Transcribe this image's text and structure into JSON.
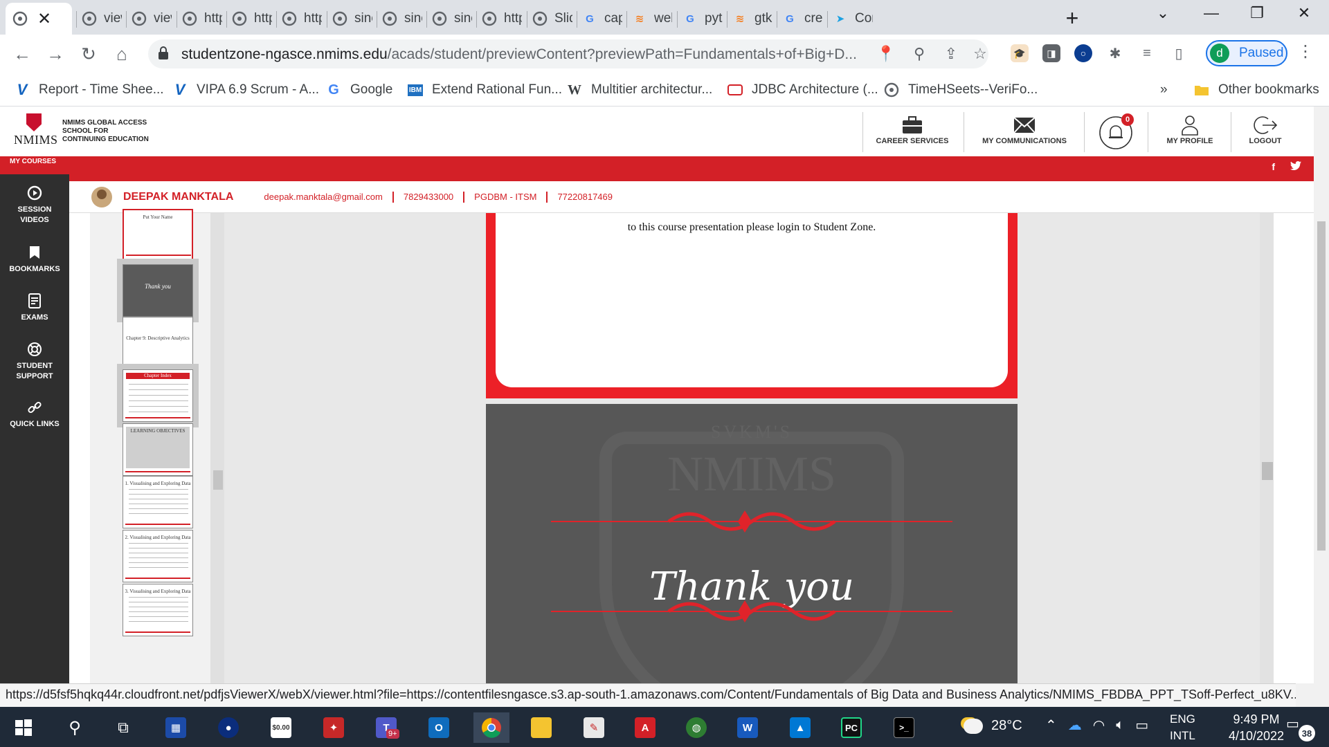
{
  "browser": {
    "tabs": [
      {
        "title": "view",
        "icon": "globe-icon"
      },
      {
        "title": "view",
        "icon": "globe-icon"
      },
      {
        "title": "http",
        "icon": "globe-icon"
      },
      {
        "title": "http",
        "icon": "globe-icon"
      },
      {
        "title": "http",
        "icon": "globe-icon"
      },
      {
        "title": "sinc",
        "icon": "globe-icon"
      },
      {
        "title": "sinc",
        "icon": "globe-icon"
      },
      {
        "title": "sinc",
        "icon": "globe-icon"
      },
      {
        "title": "http",
        "icon": "globe-icon"
      },
      {
        "title": "Slid",
        "icon": "globe-icon"
      },
      {
        "title": "cap",
        "icon": "google-icon"
      },
      {
        "title": "web",
        "icon": "stack-icon"
      },
      {
        "title": "pyth",
        "icon": "google-icon"
      },
      {
        "title": "gtk",
        "icon": "stack-icon"
      },
      {
        "title": "crea",
        "icon": "google-icon"
      },
      {
        "title": "Con",
        "icon": "fish-icon"
      }
    ],
    "url_host": "studentzone-ngasce.nmims.edu",
    "url_rest": "/acads/student/previewContent?previewPath=Fundamentals+of+Big+D...",
    "profile_initial": "d",
    "profile_status": "Paused",
    "bookmarks": [
      {
        "label": "Report - Time Shee...",
        "icon": "v-icon"
      },
      {
        "label": "VIPA 6.9 Scrum - A...",
        "icon": "v-icon"
      },
      {
        "label": "Google",
        "icon": "google-icon"
      },
      {
        "label": "Extend Rational Fun...",
        "icon": "ibm-icon"
      },
      {
        "label": "Multitier architectur...",
        "icon": "wikipedia-icon"
      },
      {
        "label": "JDBC Architecture (...",
        "icon": "jdbc-icon"
      },
      {
        "label": "TimeHSeets--VeriFo...",
        "icon": "globe-icon"
      }
    ],
    "bookmarks_more": "»",
    "other_bookmarks": "Other bookmarks",
    "status_url": "https://d5fsf5hqkq44r.cloudfront.net/pdfjsViewerX/webX/viewer.html?file=https://contentfilesngasce.s3.ap-south-1.amazonaws.com/Content/Fundamentals of Big Data and Business Analytics/NMIMS_FBDBA_PPT_TSoff-Perfect_u8KV..."
  },
  "site": {
    "logo_word": "NMIMS",
    "school_lines": [
      "NMIMS GLOBAL ACCESS",
      "SCHOOL FOR",
      "CONTINUING EDUCATION"
    ],
    "nav": {
      "career": "CAREER SERVICES",
      "communications": "MY COMMUNICATIONS",
      "notifications_count": "0",
      "profile": "MY PROFILE",
      "logout": "LOGOUT"
    },
    "social": {
      "facebook": "f",
      "twitter": "t"
    },
    "sidebar": {
      "my_courses": "MY COURSES",
      "items": [
        {
          "label_1": "SESSION",
          "label_2": "VIDEOS"
        },
        {
          "label_1": "BOOKMARKS",
          "label_2": ""
        },
        {
          "label_1": "EXAMS",
          "label_2": ""
        },
        {
          "label_1": "STUDENT",
          "label_2": "SUPPORT"
        },
        {
          "label_1": "QUICK LINKS",
          "label_2": ""
        }
      ]
    },
    "user": {
      "name": "DEEPAK MANKTALA",
      "email": "deepak.manktala@gmail.com",
      "phone": "7829433000",
      "program": "PGDBM - ITSM",
      "id": "77220817469"
    }
  },
  "viewer": {
    "thumbnails": [
      {
        "caption": "Put Your Name"
      },
      {
        "caption": "Thank you"
      },
      {
        "caption": "Chapter 9: Descriptive Analytics"
      },
      {
        "caption": "Chapter Index"
      },
      {
        "caption": "LEARNING OBJECTIVES"
      },
      {
        "caption": "1. Visualising and Exploring Data"
      },
      {
        "caption": "2. Visualising and Exploring Data"
      },
      {
        "caption": "3. Visualising and Exploring Data"
      }
    ],
    "slide1_text": "to this course presentation please login to Student Zone.",
    "slide2_watermark_top": "SVKM'S",
    "slide2_watermark_main": "NMIMS",
    "slide2_text": "Thank you"
  },
  "taskbar": {
    "temperature": "28°C",
    "lang_1": "ENG",
    "lang_2": "INTL",
    "time": "9:49 PM",
    "date": "4/10/2022",
    "notifications": "38",
    "teams_badge": "9+"
  }
}
